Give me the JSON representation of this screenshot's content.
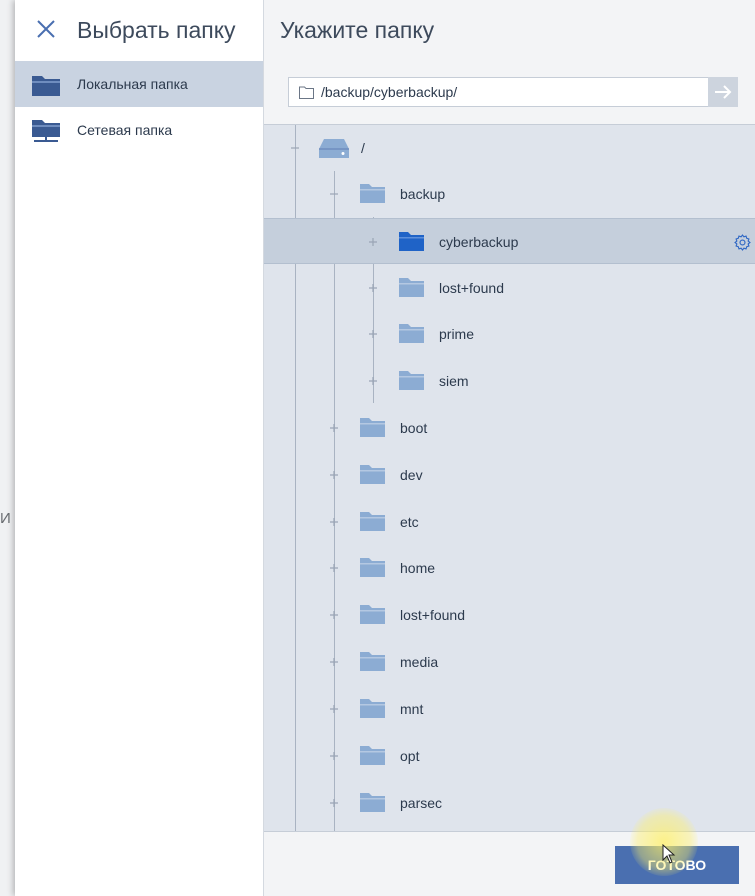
{
  "backdrop": {
    "text": "И"
  },
  "left_panel": {
    "title": "Выбрать папку",
    "nav": [
      {
        "label": "Локальная папка",
        "icon": "folder-icon",
        "active": true
      },
      {
        "label": "Сетевая папка",
        "icon": "network-folder-icon",
        "active": false
      }
    ]
  },
  "right_panel": {
    "title": "Укажите папку",
    "path": {
      "value": "/backup/cyberbackup/"
    },
    "tree": {
      "root": {
        "label": "/",
        "icon": "drive-icon"
      },
      "items": [
        {
          "label": "backup",
          "level": 1,
          "expanded": true
        },
        {
          "label": "cyberbackup",
          "level": 2,
          "selected": true
        },
        {
          "label": "lost+found",
          "level": 2
        },
        {
          "label": "prime",
          "level": 2
        },
        {
          "label": "siem",
          "level": 2
        },
        {
          "label": "boot",
          "level": 1
        },
        {
          "label": "dev",
          "level": 1
        },
        {
          "label": "etc",
          "level": 1
        },
        {
          "label": "home",
          "level": 1
        },
        {
          "label": "lost+found",
          "level": 1
        },
        {
          "label": "media",
          "level": 1
        },
        {
          "label": "mnt",
          "level": 1
        },
        {
          "label": "opt",
          "level": 1
        },
        {
          "label": "parsec",
          "level": 1
        }
      ]
    },
    "done_label": "ГОТОВО"
  },
  "colors": {
    "accent": "#4a6fb0",
    "folder": "#8cacd3",
    "folder_selected": "#1f63c7",
    "selection": "#c5cfdc",
    "tree_bg": "#dfe4ec"
  }
}
